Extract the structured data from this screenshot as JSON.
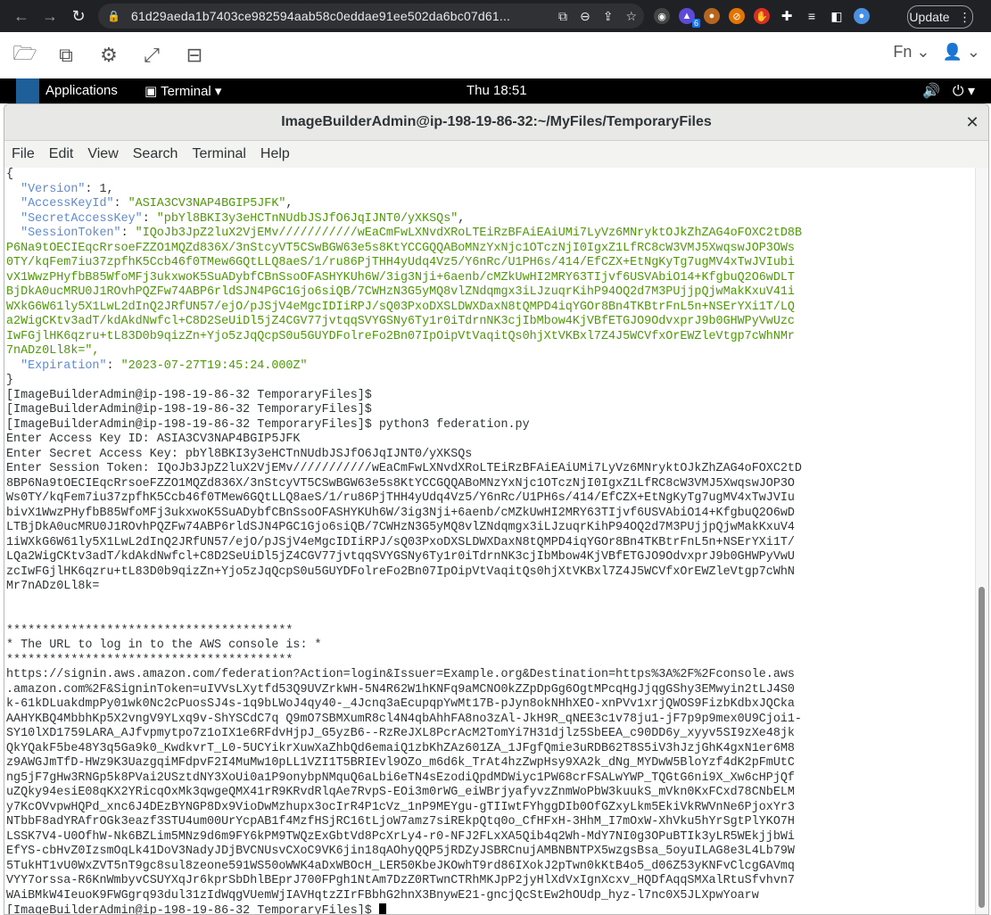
{
  "browser": {
    "url": "61d29aeda1b7403ce982594aab58c0eddae91ee502da6bc07d61...",
    "extension_badge": "6",
    "update_label": "Update"
  },
  "toolbar": {
    "fn_label": "Fn"
  },
  "gnome": {
    "applications_label": "Applications",
    "terminal_label": "Terminal",
    "clock": "Thu 18:51"
  },
  "window": {
    "title": "ImageBuilderAdmin@ip-198-19-86-32:~/MyFiles/TemporaryFiles",
    "menu": [
      "File",
      "Edit",
      "View",
      "Search",
      "Terminal",
      "Help"
    ]
  },
  "terminal": {
    "json_open": "{",
    "version_key": "\"Version\"",
    "version_val": "1",
    "access_key_id_key": "\"AccessKeyId\"",
    "access_key_id_val": "\"ASIA3CV3NAP4BGIP5JFK\"",
    "secret_key": "\"SecretAccessKey\"",
    "secret_val": "\"pbYl8BKI3y3eHCTnNUdbJSJfO6JqIJNT0/yXKSQs\"",
    "session_key": "\"SessionToken\"",
    "session_lines": [
      "\"IQoJb3JpZ2luX2VjEMv///////////wEaCmFwLXNvdXRoLTEiRzBFAiEAiUMi7LyVz6MNryktOJkZhZAG4oFOXC2tD8B",
      "P6Na9tOECIEqcRrsoeFZZO1MQZd836X/3nStcyVT5CSwBGW63e5s8KtYCCGQQABoMNzYxNjc1OTczNjI0IgxZ1LfRC8cW3VMJ5XwqswJOP3OWs",
      "0TY/kqFem7iu37zpfhK5Ccb46f0TMew6GQtLLQ8aeS/1/ru86PjTHH4yUdq4Vz5/Y6nRc/U1PH6s/414/EfCZX+EtNgKyTg7ugMV4xTwJVIubi",
      "vX1WwzPHyfbB85WfoMFj3ukxwoK5SuADybfCBnSsoOFASHYKUh6W/3ig3Nji+6aenb/cMZkUwHI2MRY63TIjvf6USVAbiO14+KfgbuQ2O6wDLT",
      "BjDkA0ucMRU0J1ROvhPQZFw74ABP6rldSJN4PGC1Gjo6siQB/7CWHzN3G5yMQ8vlZNdqmgx3iLJzuqrKihP94OQ2d7M3PUjjpQjwMakKxuV41i",
      "WXkG6W61ly5X1LwL2dInQ2JRfUN57/ejO/pJSjV4eMgcIDIiRPJ/sQ03PxoDXSLDWXDaxN8tQMPD4iqYGOr8Bn4TKBtrFnL5n+NSErYXi1T/LQ",
      "a2WigCKtv3adT/kdAkdNwfcl+C8D2SeUiDl5jZ4CGV77jvtqqSVYGSNy6Ty1r0iTdrnNK3cjIbMbow4KjVBfETGJO9OdvxprJ9b0GHWPyVwUzc",
      "IwFGjlHK6qzru+tL83D0b9qizZn+Yjo5zJqQcpS0u5GUYDFolreFo2Bn07IpOipVtVaqitQs0hjXtVKBxl7Z4J5WCVfxOrEWZleVtgp7cWhNMr",
      "7nADz0Ll8k=\","
    ],
    "expiration_key": "\"Expiration\"",
    "expiration_val": "\"2023-07-27T19:45:24.000Z\"",
    "json_close": "}",
    "prompt1": "[ImageBuilderAdmin@ip-198-19-86-32 TemporaryFiles]$",
    "prompt2": "[ImageBuilderAdmin@ip-198-19-86-32 TemporaryFiles]$",
    "prompt3": "[ImageBuilderAdmin@ip-198-19-86-32 TemporaryFiles]$ python3 federation.py",
    "enter_access": "Enter Access Key ID: ASIA3CV3NAP4BGIP5JFK",
    "enter_secret": "Enter Secret Access Key: pbYl8BKI3y3eHCTnNUdbJSJfO6JqIJNT0/yXKSQs",
    "enter_session_lines": [
      "Enter Session Token: IQoJb3JpZ2luX2VjEMv///////////wEaCmFwLXNvdXRoLTEiRzBFAiEAiUMi7LyVz6MNryktOJkZhZAG4oFOXC2tD",
      "8BP6Na9tOECIEqcRrsoeFZZO1MQZd836X/3nStcyVT5CSwBGW63e5s8KtYCCGQQABoMNzYxNjc1OTczNjI0IgxZ1LfRC8cW3VMJ5XwqswJOP3O",
      "Ws0TY/kqFem7iu37zpfhK5Ccb46f0TMew6GQtLLQ8aeS/1/ru86PjTHH4yUdq4Vz5/Y6nRc/U1PH6s/414/EfCZX+EtNgKyTg7ugMV4xTwJVIu",
      "bivX1WwzPHyfbB85WfoMFj3ukxwoK5SuADybfCBnSsoOFASHYKUh6W/3ig3Nji+6aenb/cMZkUwHI2MRY63TIjvf6USVAbiO14+KfgbuQ2O6wD",
      "LTBjDkA0ucMRU0J1ROvhPQZFw74ABP6rldSJN4PGC1Gjo6siQB/7CWHzN3G5yMQ8vlZNdqmgx3iLJzuqrKihP94OQ2d7M3PUjjpQjwMakKxuV4",
      "1iWXkG6W61ly5X1LwL2dInQ2JRfUN57/ejO/pJSjV4eMgcIDIiRPJ/sQ03PxoDXSLDWXDaxN8tQMPD4iqYGOr8Bn4TKBtrFnL5n+NSErYXi1T/",
      "LQa2WigCKtv3adT/kdAkdNwfcl+C8D2SeUiDl5jZ4CGV77jvtqqSVYGSNy6Ty1r0iTdrnNK3cjIbMbow4KjVBfETGJO9OdvxprJ9b0GHWPyVwU",
      "zcIwFGjlHK6qzru+tL83D0b9qizZn+Yjo5zJqQcpS0u5GUYDFolreFo2Bn07IpOipVtVaqitQs0hjXtVKBxl7Z4J5WCVfxOrEWZleVtgp7cWhN",
      "Mr7nADz0Ll8k="
    ],
    "stars": "****************************************",
    "url_msg": "* The URL to log in to the AWS console is: *",
    "url_lines": [
      "https://signin.aws.amazon.com/federation?Action=login&Issuer=Example.org&Destination=https%3A%2F%2Fconsole.aws",
      ".amazon.com%2F&SigninToken=uIVVsLXytfd53Q9UVZrkWH-5N4R62W1hKNFq9aMCNO0kZZpDpGg6OgtMPcqHgJjqgGShy3EMwyin2tLJ4S0",
      "k-61kDLuakdmpPy01wk0Nc2cPuosSJ4s-1q9bLWoJ4qy40-_4Jcnq3aEcupqpYwMt17B-pJyn8okNHhXEO-xnPVv1xrjQWOS9FizbKdbxJQCka",
      "AAHYKBQ4MbbhKp5X2vngV9YLxq9v-ShYSCdC7q Q9mO7SBMXumR8cl4N4qbAhhFA8no3zAl-JkH9R_qNEE3c1v78ju1-jF7p9p9mex0U9Cjoi1-",
      "SY10lXD1759LARA_AJfvpmytpo7z1oIX1e6RFdvHjpJ_G5yzB6--RzReJXL8PcrAcM2TomYi7H31djlz5SbEEA_c90DD6y_xyyv5SI9zXe48jk",
      "QkYQakF5be48Y3q5Ga9k0_KwdkvrT_L0-5UCYikrXuwXaZhbQd6emaiQ1zbKhZAz601ZA_1JFgfQmie3uRDB62T8S5iV3hJzjGhK4gxN1er6M8",
      "z9AWGJmTfD-HWz9K3UazgqiMFdpvF2I4MuMw10pLL1VZI1T5BRIEvl9OZo_m6d6k_TrAt4hzZwpHsy9XA2k_dNg_MYDwW5BloYzf4dK2pFmUtC",
      "ng5jF7gHw3RNGp5k8PVai2USztdNY3XoUi0a1P9onybpNMquQ6aLbi6eTN4sEzodiQpdMDWiyc1PW68crFSALwYWP_TQGtG6ni9X_Xw6cHPjQf",
      "uZQky94esiE08qKX2YRicqOxMk3qwgeQMX41rR9KRvdRlqAe7RvpS-EOi3m0rWG_eiWBrjyafyvzZnmWoPbW3kuukS_mVkn0KxFCxd78CNbELM",
      "y7KcOVvpwHQPd_xnc6J4DEzBYNGP8Dx9VioDwMzhupx3ocIrR4P1cVz_1nP9MEYgu-gTIIwtFYhggDIb0OfGZxyLkm5EkiVkRWVnNe6PjoxYr3",
      "NTbbF8adYRAfrOGk3eazf3STU4um00UrYcpAB1f4MzfHSjRC16tLjoW7amz7siREkpQtq0o_CfHFxH-3HhM_I7mOxW-XhVku5hYrSgtPlYKO7H",
      "LSSK7V4-U0OfhW-Nk6BZLim5MNz9d6m9FY6kPM9TWQzExGbtVd8PcXrLy4-r0-NFJ2FLxXA5Qib4q2Wh-MdY7NI0g3OPuBTIk3yLR5WEkjjbWi",
      "EfYS-cbHvZ0IzsmOqLk41DoV3NadyJDjBVCNUsvCXoC9VK6jin18qAOhyQQP5jRDZyJSBRCnujAMBNBNTPX5wzgsBsa_5oyuILAG8e3L4Lb79W",
      "5TukHT1vU0WxZVT5nT9gc8sul8zeone591WS50oWWK4aDxWBOcH_LER50KbeJKOwhT9rd86IXokJ2pTwn0kKtB4o5_d06Z53yKNFvClcgGAVmq",
      "VYY7orssa-R6KnWmbyvCSUYXqJr6kprSbDhlBEprJ700FPgh1NtAm7DzZ0RTwnCTRhMKJpP2jyHlXdVxIgnXcxv_HQDfAqqSMXalRtuSfvhvn7",
      "WAiBMkW4IeuoK9FWGgrq93dul31zIdWqgVUemWjIAVHqtzZIrFBbhG2hnX3BnywE21-gncjQcStEw2hOUdp_hyz-l7nc0X5JLXpwYoarw"
    ],
    "prompt_final": "[ImageBuilderAdmin@ip-198-19-86-32 TemporaryFiles]$"
  }
}
